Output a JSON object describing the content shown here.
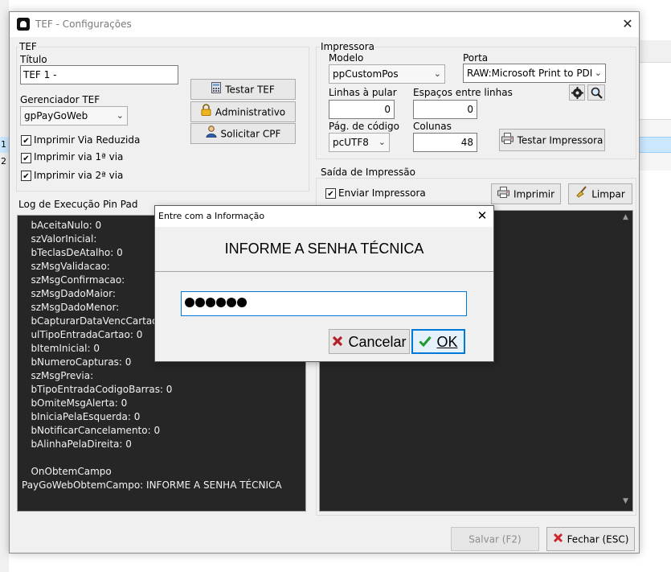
{
  "background": {
    "rows": [
      "1",
      "2"
    ]
  },
  "window": {
    "title": "TEF - Configurações",
    "close_glyph": "✕"
  },
  "tef": {
    "legend": "TEF",
    "titulo_label": "Título",
    "titulo_value": "TEF 1 -",
    "gerenciador_label": "Gerenciador TEF",
    "gerenciador_value": "gpPayGoWeb",
    "chk_reduzida": "Imprimir Via Reduzida",
    "chk_via1": "Imprimir via 1ª via",
    "chk_via2": "Imprimir via 2ª via",
    "btn_testar": "Testar TEF",
    "btn_admin": "Administrativo",
    "btn_cpf": "Solicitar CPF"
  },
  "impressora": {
    "legend": "Impressora",
    "modelo_label": "Modelo",
    "modelo_value": "ppCustomPos",
    "porta_label": "Porta",
    "porta_value": "RAW:Microsoft Print to PDI",
    "linhas_label": "Linhas à pular",
    "linhas_value": "0",
    "espacos_label": "Espaços entre linhas",
    "espacos_value": "0",
    "pagcod_label": "Pág. de código",
    "pagcod_value": "pcUTF8",
    "colunas_label": "Colunas",
    "colunas_value": "48",
    "btn_testar_impressora": "Testar Impressora"
  },
  "saida": {
    "legend": "Saída de Impressão",
    "chk_enviar": "Enviar Impressora",
    "btn_imprimir": "Imprimir",
    "btn_limpar": "Limpar"
  },
  "log": {
    "label": "Log de Execução Pin Pad",
    "lines": [
      "   bAceitaNulo: 0",
      "   szValorInicial:",
      "   bTeclasDeAtalho: 0",
      "   szMsgValidacao:",
      "   szMsgConfirmacao:",
      "   szMsgDadoMaior:",
      "   szMsgDadoMenor:",
      "   bCapturarDataVencCartao:",
      "   ulTipoEntradaCartao: 0",
      "   bItemInicial: 0",
      "   bNumeroCapturas: 0",
      "   szMsgPrevia:",
      "   bTipoEntradaCodigoBarras: 0",
      "   bOmiteMsgAlerta: 0",
      "   bIniciaPelaEsquerda: 0",
      "   bNotificarCancelamento: 0",
      "   bAlinhaPelaDireita: 0",
      "",
      "   OnObtemCampo",
      "PayGoWebObtemCampo: INFORME A SENHA TÉCNICA"
    ]
  },
  "footer": {
    "btn_salvar": "Salvar (F2)",
    "btn_fechar": "Fechar (ESC)"
  },
  "dialog": {
    "title": "Entre com a Informação",
    "close_glyph": "✕",
    "message": "INFORME A SENHA TÉCNICA",
    "password_length": 6,
    "btn_cancel": "Cancelar",
    "btn_ok": "OK"
  }
}
